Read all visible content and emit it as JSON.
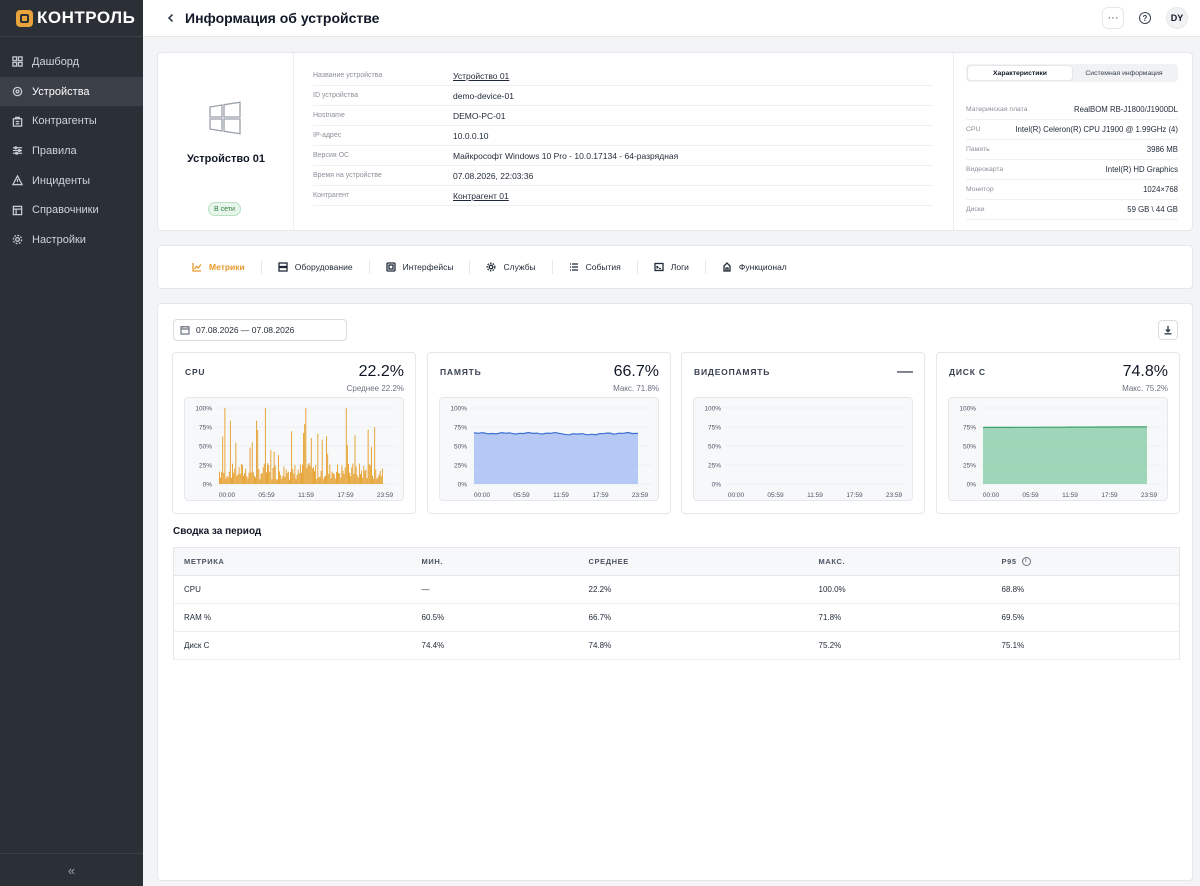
{
  "app": {
    "name": "КОНТРОЛЬ"
  },
  "sidebar": {
    "items": [
      {
        "label": "Дашборд",
        "icon": "dashboard-icon",
        "active": false
      },
      {
        "label": "Устройства",
        "icon": "devices-icon",
        "active": true
      },
      {
        "label": "Контрагенты",
        "icon": "counterparties-icon",
        "active": false
      },
      {
        "label": "Правила",
        "icon": "rules-icon",
        "active": false
      },
      {
        "label": "Инциденты",
        "icon": "incidents-icon",
        "active": false
      },
      {
        "label": "Справочники",
        "icon": "directories-icon",
        "active": false
      },
      {
        "label": "Настройки",
        "icon": "settings-icon",
        "active": false
      }
    ],
    "collapse_label": "«"
  },
  "header": {
    "title": "Информация об устройстве",
    "more_label": "···",
    "help_label": "?",
    "avatar": "DY"
  },
  "device": {
    "name": "Устройство 01",
    "status": "В сети",
    "properties": [
      {
        "label": "Название устройства",
        "value": "Устройство 01",
        "link": true
      },
      {
        "label": "ID устройства",
        "value": "demo-device-01",
        "link": false
      },
      {
        "label": "Hostname",
        "value": "DEMO-PC-01",
        "link": false
      },
      {
        "label": "IP-адрес",
        "value": "10.0.0.10",
        "link": false
      },
      {
        "label": "Версия ОС",
        "value": "Майкрософт Windows 10 Pro - 10.0.17134 - 64-разрядная",
        "link": false
      },
      {
        "label": "Время на устройстве",
        "value": "07.08.2026, 22:03:36",
        "link": false
      },
      {
        "label": "Контрагент",
        "value": "Контрагент 01",
        "link": true
      }
    ]
  },
  "hardware": {
    "tabs": [
      "Характеристики",
      "Системная информация"
    ],
    "rows": [
      {
        "label": "Материнская плата",
        "value": "RealBOM RB-J1800/J1900DL"
      },
      {
        "label": "CPU",
        "value": "Intel(R) Celeron(R) CPU J1900 @ 1.99GHz (4)"
      },
      {
        "label": "Память",
        "value": "3986 MB"
      },
      {
        "label": "Видеокарта",
        "value": "Intel(R) HD Graphics"
      },
      {
        "label": "Монитор",
        "value": "1024×768"
      },
      {
        "label": "Диски",
        "value": "59 GB \\ 44 GB"
      }
    ]
  },
  "tabs": [
    {
      "label": "Метрики",
      "icon": "chart-icon",
      "active": true
    },
    {
      "label": "Оборудование",
      "icon": "hardware-icon",
      "active": false
    },
    {
      "label": "Интерфейсы",
      "icon": "interfaces-icon",
      "active": false
    },
    {
      "label": "Службы",
      "icon": "services-icon",
      "active": false
    },
    {
      "label": "События",
      "icon": "events-icon",
      "active": false
    },
    {
      "label": "Логи",
      "icon": "logs-icon",
      "active": false
    },
    {
      "label": "Функционал",
      "icon": "functionality-icon",
      "active": false
    }
  ],
  "metrics": {
    "date_range": "07.08.2026 — 07.08.2026",
    "cards": [
      {
        "title": "CPU",
        "value": "22.2%",
        "sub": "Среднее 22.2%",
        "color": "#e59a1f",
        "fill": "#eea83a"
      },
      {
        "title": "ПАМЯТЬ",
        "value": "66.7%",
        "sub": "Макс. 71.8%",
        "color": "#3b6fd1",
        "fill": "#a9c1f2"
      },
      {
        "title": "ВИДЕОПАМЯТЬ",
        "value": "—",
        "sub": "",
        "color": "#9ca3af",
        "fill": "#e5e7eb"
      },
      {
        "title": "ДИСК C",
        "value": "74.8%",
        "sub": "Макс. 75.2%",
        "color": "#3aa06a",
        "fill": "#8fd0ad"
      }
    ],
    "axis": {
      "y_ticks": [
        "100%",
        "75%",
        "50%",
        "25%",
        "0%"
      ],
      "x_ticks": [
        "00:00",
        "05:59",
        "11:59",
        "17:59",
        "23:59"
      ]
    }
  },
  "chart_data": [
    {
      "type": "bar",
      "title": "CPU",
      "x_ticks": [
        "00:00",
        "05:59",
        "11:59",
        "17:59",
        "23:59"
      ],
      "ylim": [
        0,
        100
      ],
      "y_ticks": [
        "100%",
        "75%",
        "50%",
        "25%",
        "0%"
      ],
      "mean": 22.2,
      "min": 0,
      "max": 100.0
    },
    {
      "type": "area",
      "title": "ПАМЯТЬ",
      "x_ticks": [
        "00:00",
        "05:59",
        "11:59",
        "17:59",
        "23:59"
      ],
      "ylim": [
        0,
        100
      ],
      "y_ticks": [
        "100%",
        "75%",
        "50%",
        "25%",
        "0%"
      ],
      "level": 66.7,
      "min": 60.5,
      "max": 71.8
    },
    {
      "type": "line",
      "title": "ВИДЕОПАМЯТЬ",
      "x_ticks": [
        "00:00",
        "05:59",
        "11:59",
        "17:59",
        "23:59"
      ],
      "ylim": [
        0,
        100
      ],
      "y_ticks": [
        "100%",
        "75%",
        "50%",
        "25%",
        "0%"
      ]
    },
    {
      "type": "area",
      "title": "ДИСК C",
      "x_ticks": [
        "00:00",
        "05:59",
        "11:59",
        "17:59",
        "23:59"
      ],
      "ylim": [
        0,
        100
      ],
      "y_ticks": [
        "100%",
        "75%",
        "50%",
        "25%",
        "0%"
      ],
      "level": 74.8,
      "min": 74.4,
      "max": 75.2
    }
  ],
  "summary": {
    "title": "Сводка за период",
    "columns": [
      "МЕТРИКА",
      "МИН.",
      "СРЕДНЕЕ",
      "МАКС.",
      "P95"
    ],
    "rows": [
      [
        "CPU",
        "—",
        "22.2%",
        "100.0%",
        "68.8%"
      ],
      [
        "RAM %",
        "60.5%",
        "66.7%",
        "71.8%",
        "69.5%"
      ],
      [
        "Диск C",
        "74.4%",
        "74.8%",
        "75.2%",
        "75.1%"
      ]
    ]
  }
}
